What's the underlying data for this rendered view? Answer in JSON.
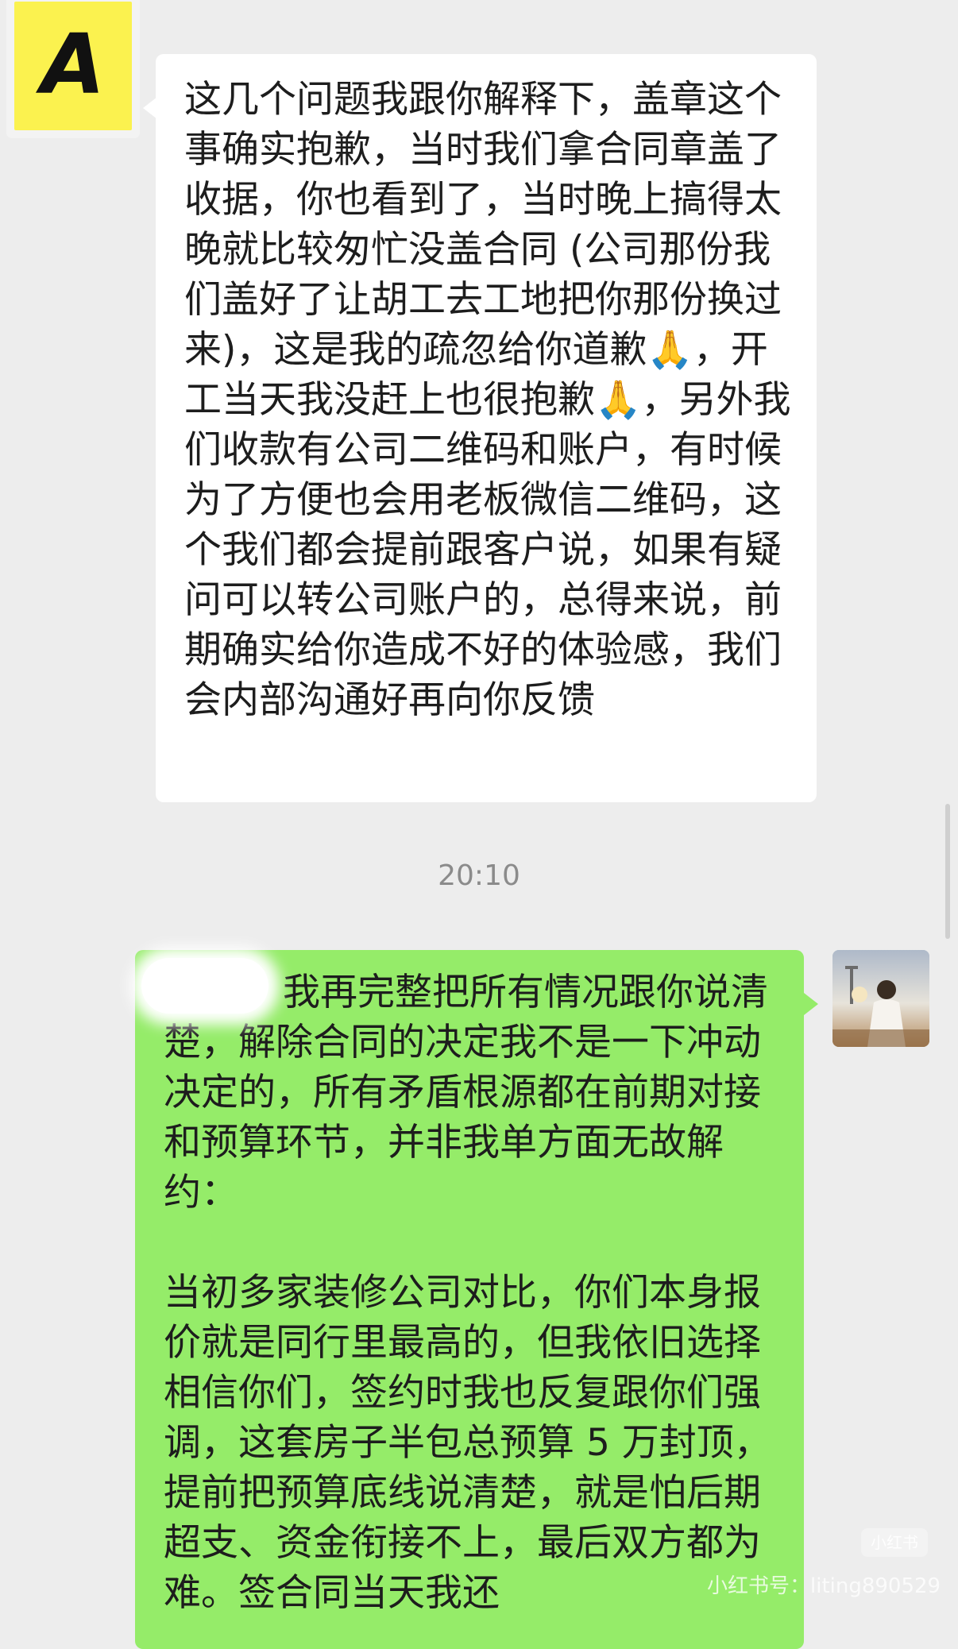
{
  "contacts": {
    "other": {
      "avatar_letter": "A"
    },
    "me": {
      "avatar": "user-photo-avatar"
    }
  },
  "messages": {
    "incoming_1": "这几个问题我跟你解释下，盖章这个事确实抱歉，当时我们拿合同章盖了收据，你也看到了，当时晚上搞得太晚就比较匆忙没盖合同 (公司那份我们盖好了让胡工去工地把你那份换过来)，这是我的疏忽给你道歉🙏，开工当天我没赶上也很抱歉🙏，另外我们收款有公司二维码和账户，有时候为了方便也会用老板微信二维码，这个我们都会提前跟客户说，如果有疑问可以转公司账户的，总得来说，前期确实给你造成不好的体验感，我们会内部沟通好再向你反馈",
    "timestamp": "20:10",
    "outgoing_1": "我再完整把所有情况跟你说清楚，解除合同的决定我不是一下冲动决定的，所有矛盾根源都在前期对接和预算环节，并非我单方面无故解约：\n\n当初多家装修公司对比，你们本身报价就是同行里最高的，但我依旧选择相信你们，签约时我也反复跟你们强调，这套房子半包总预算 5 万封顶，提前把预算底线说清楚，就是怕后期超支、资金衔接不上，最后双方都为难。签合同当天我还"
  },
  "watermark": {
    "badge": "小红书",
    "text": "小红书号：liting890529"
  },
  "colors": {
    "chat_bg": "#ededed",
    "incoming_bubble": "#ffffff",
    "outgoing_bubble": "#95ec69",
    "avatar_yellow": "#fbf24f"
  }
}
